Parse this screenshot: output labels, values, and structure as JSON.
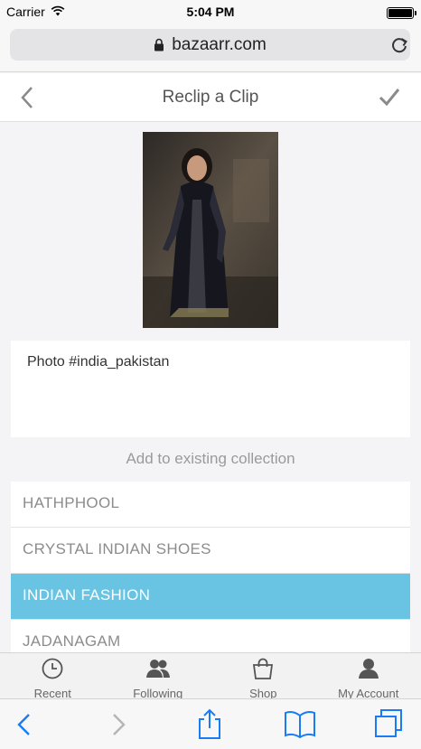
{
  "status": {
    "carrier": "Carrier",
    "time": "5:04 PM"
  },
  "browser": {
    "url": "bazaarr.com"
  },
  "header": {
    "title": "Reclip a Clip"
  },
  "caption": {
    "text": "Photo #india_pakistan"
  },
  "collections": {
    "label": "Add to existing collection",
    "items": [
      {
        "name": "HATHPHOOL",
        "selected": false
      },
      {
        "name": "CRYSTAL INDIAN SHOES",
        "selected": false
      },
      {
        "name": "INDIAN FASHION",
        "selected": true
      },
      {
        "name": "JADANAGAM",
        "selected": false
      }
    ]
  },
  "tabs": [
    {
      "label": "Recent",
      "icon": "clock-icon"
    },
    {
      "label": "Following",
      "icon": "people-icon"
    },
    {
      "label": "Shop",
      "icon": "shopping-bag-icon"
    },
    {
      "label": "My Account",
      "icon": "person-icon"
    }
  ],
  "colors": {
    "accent": "#69c3e3",
    "ios_blue": "#1a7cf5"
  }
}
